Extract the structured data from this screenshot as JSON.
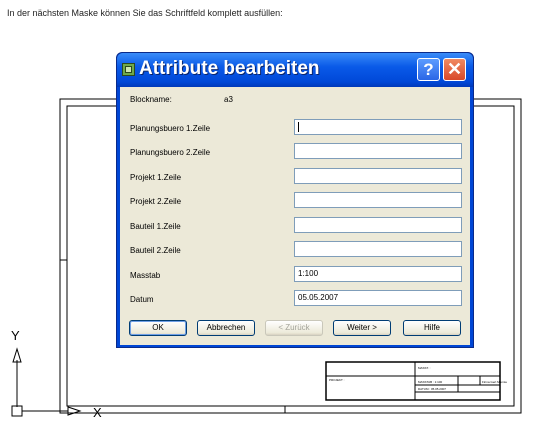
{
  "intro_text": "In der nächsten Maske können Sie das Schriftfeld komplett ausfüllen:",
  "dialog": {
    "title": "Attribute bearbeiten",
    "help_label": "?",
    "close_label": "✕",
    "blockname_label": "Blockname:",
    "blockname_value": "a3",
    "fields": [
      {
        "label": "Planungsbuero 1.Zeile",
        "value": ""
      },
      {
        "label": "Planungsbuero 2.Zeile",
        "value": ""
      },
      {
        "label": "Projekt 1.Zeile",
        "value": ""
      },
      {
        "label": "Projekt 2.Zeile",
        "value": ""
      },
      {
        "label": "Bauteil 1.Zeile",
        "value": ""
      },
      {
        "label": "Bauteil 2.Zeile",
        "value": ""
      },
      {
        "label": "Masstab",
        "value": "1:100"
      },
      {
        "label": "Datum",
        "value": "05.05.2007"
      }
    ],
    "buttons": {
      "ok": "OK",
      "cancel": "Abbrechen",
      "back": "< Zurück",
      "next": "Weiter >",
      "help": "Hilfe"
    }
  },
  "cad": {
    "axis_y": "Y",
    "axis_x": "X",
    "titleblock": {
      "massstab_label": "MASST. :",
      "projekt_label": "PROJEKT :",
      "massstab_value": "MASSTAB : 1:100",
      "datum_value": "DATUM : 05.05.2007",
      "firma": "Firma Gert Mannie"
    }
  }
}
